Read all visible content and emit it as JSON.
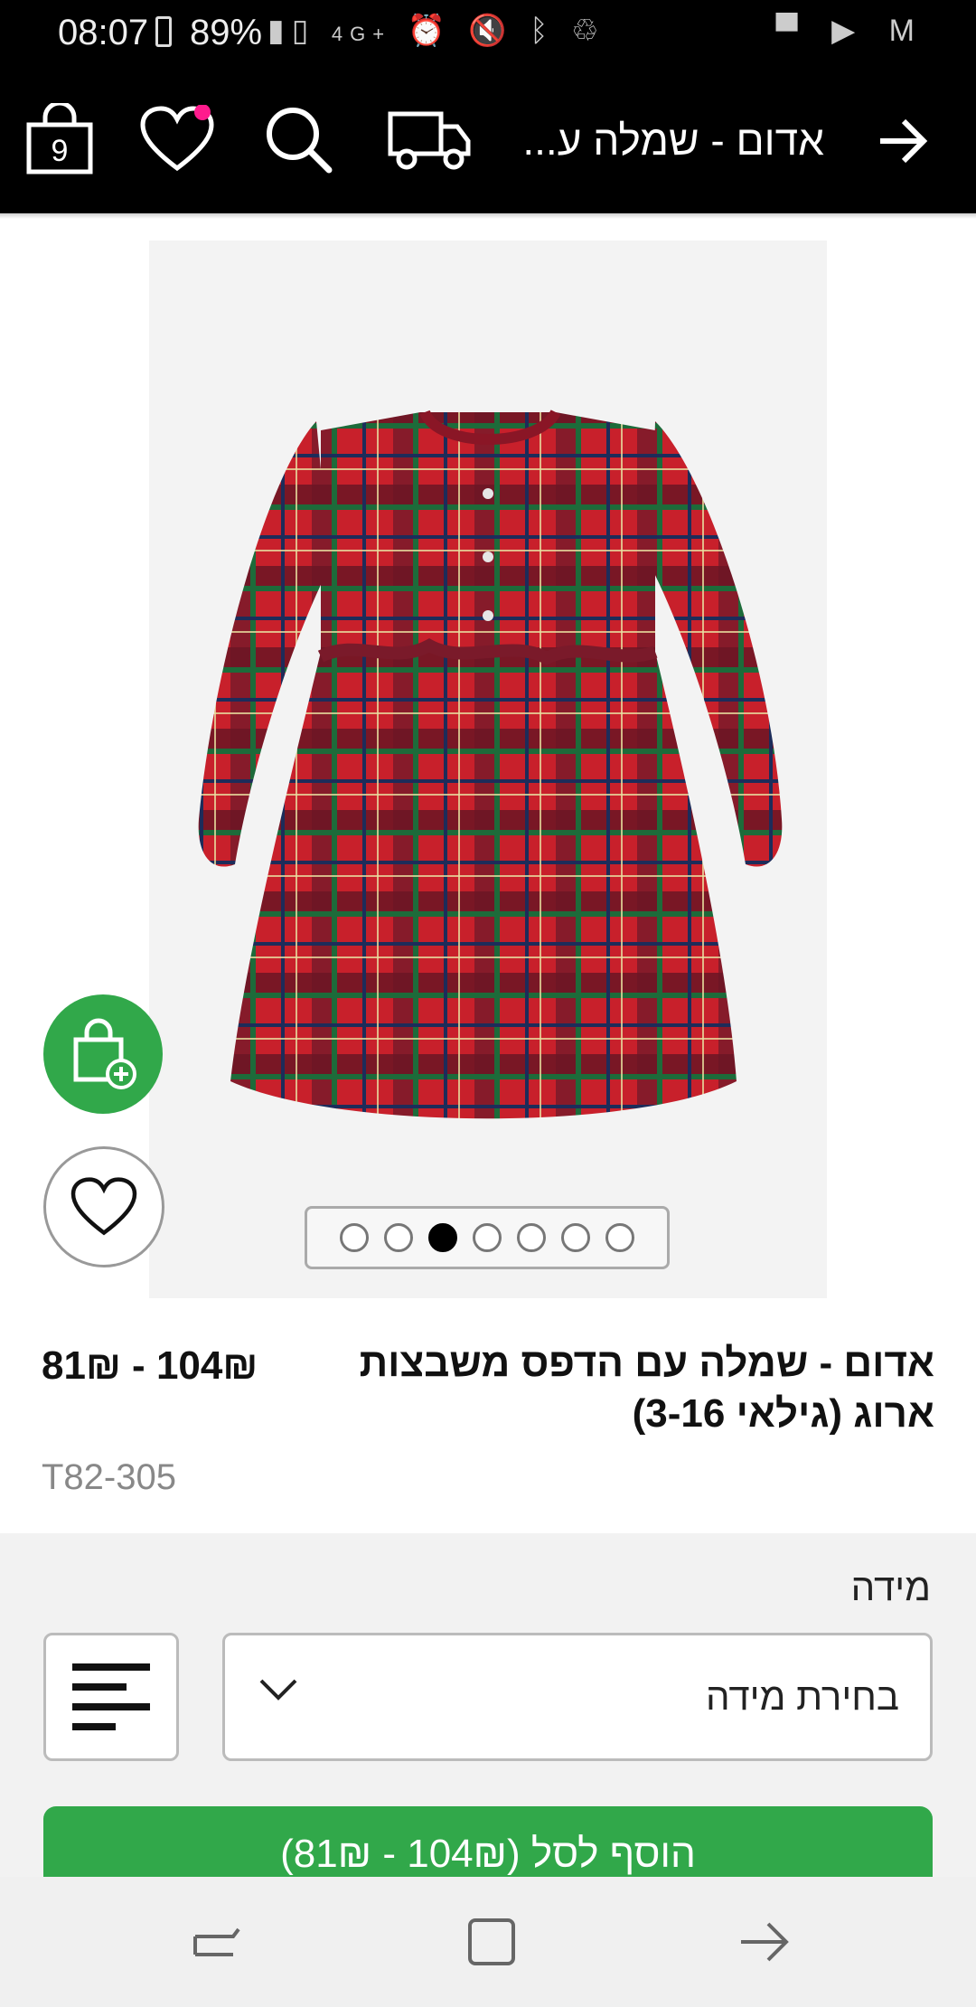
{
  "status_bar": {
    "time": "08:07",
    "battery": "89%",
    "network": "4G+"
  },
  "header": {
    "bag_count": "9",
    "title": "אדום - שמלה ע...",
    "wishlist_badge_color": "#ff1b8d"
  },
  "gallery": {
    "dot_count": 7,
    "active_dot": 3
  },
  "product": {
    "title": "אדום - שמלה עם הדפס משבצות ארוג (גילאי 3-16)",
    "price": "104₪ - 81₪",
    "sku": "T82-305"
  },
  "size": {
    "label": "מידה",
    "select_placeholder": "בחירת מידה"
  },
  "cta": {
    "label": "הוסף לסל (104₪ - 81₪)"
  },
  "colors": {
    "accent_green": "#31a84a",
    "header_bg": "#000000"
  }
}
